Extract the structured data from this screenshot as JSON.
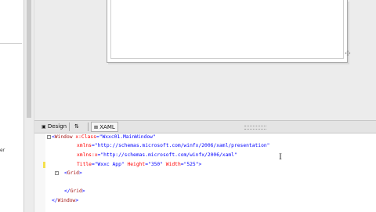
{
  "tabs": {
    "design_label": "Design",
    "swap_label": "⇅",
    "xaml_label": "XAML"
  },
  "left_edge_text": "er",
  "xaml": {
    "line1": {
      "open": "<",
      "tag": "Window",
      "attr": " x:Class",
      "eq": "=",
      "val": "\"Wxxc01.MainWindow\""
    },
    "line2": {
      "attr": "xmlns",
      "eq": "=",
      "val": "\"http://schemas.microsoft.com/winfx/2006/xaml/presentation\""
    },
    "line3": {
      "attr": "xmlns:x",
      "eq": "=",
      "val": "\"http://schemas.microsoft.com/winfx/2006/xaml\""
    },
    "line4": {
      "attr1": "Title",
      "eq1": "=",
      "val1": "\"Wxxc App\"",
      "attr2": " Height",
      "eq2": "=",
      "val2": "\"350\"",
      "attr3": " Width",
      "eq3": "=",
      "val3": "\"525\"",
      "close": ">"
    },
    "line5": {
      "open": "<",
      "tag": "Grid",
      "close": ">"
    },
    "line6": {
      "open": "</",
      "tag": "Grid",
      "close": ">"
    },
    "line7": {
      "open": "</",
      "tag": "Window",
      "close": ">"
    }
  }
}
